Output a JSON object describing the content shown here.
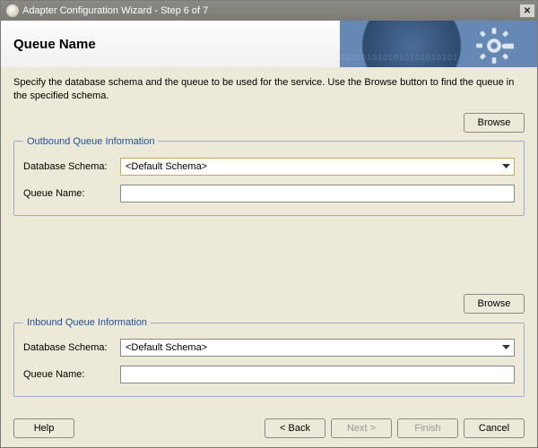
{
  "window": {
    "title": "Adapter Configuration Wizard - Step 6 of 7",
    "close_label": "✕"
  },
  "header": {
    "title": "Queue Name"
  },
  "intro": "Specify the database schema and the queue to be used for the service. Use the Browse button to find the queue in the specified schema.",
  "buttons": {
    "browse": "Browse",
    "help": "Help",
    "back": "< Back",
    "next": "Next >",
    "finish": "Finish",
    "cancel": "Cancel"
  },
  "outbound": {
    "legend": "Outbound Queue Information",
    "schema_label": "Database Schema:",
    "schema_value": "<Default Schema>",
    "queue_label": "Queue Name:",
    "queue_value": ""
  },
  "inbound": {
    "legend": "Inbound Queue Information",
    "schema_label": "Database Schema:",
    "schema_value": "<Default Schema>",
    "queue_label": "Queue Name:",
    "queue_value": ""
  }
}
